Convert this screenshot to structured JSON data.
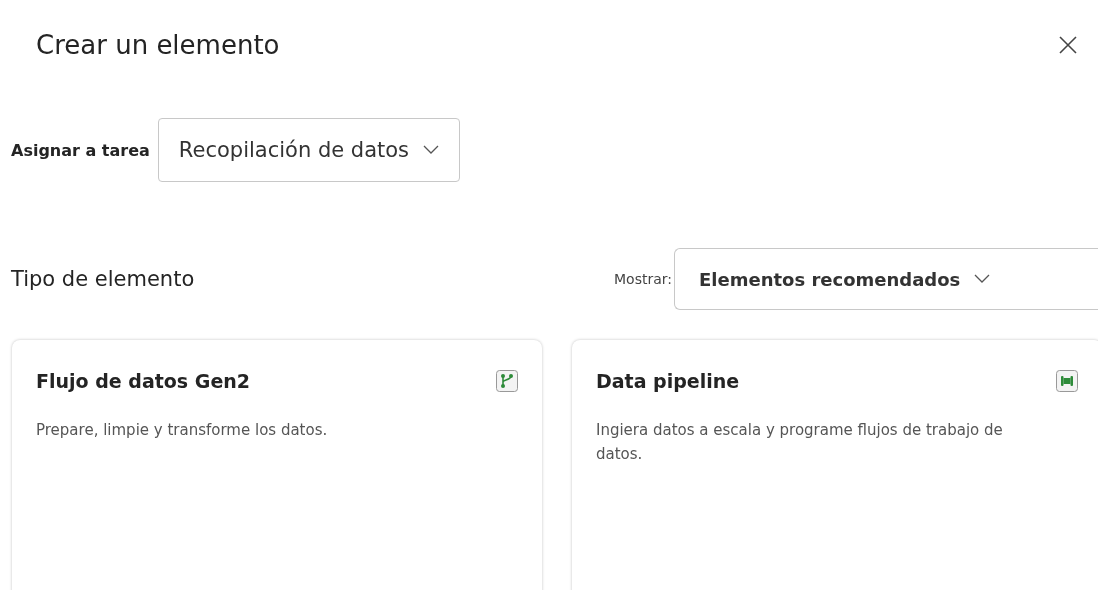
{
  "dialog": {
    "title": "Crear un elemento"
  },
  "assign": {
    "label": "Asignar a tarea",
    "value": "Recopilación de datos"
  },
  "section": {
    "title": "Tipo de elemento",
    "filter_label": "Mostrar:",
    "filter_value": "Elementos recomendados"
  },
  "cards": [
    {
      "title": "Flujo de datos Gen2",
      "description": "Prepare, limpie y transforme los datos.",
      "kind": "dataflow"
    },
    {
      "title": "Data pipeline",
      "description": "Ingiera datos a escala y programe flujos de trabajo de datos.",
      "kind": "pipeline"
    }
  ]
}
